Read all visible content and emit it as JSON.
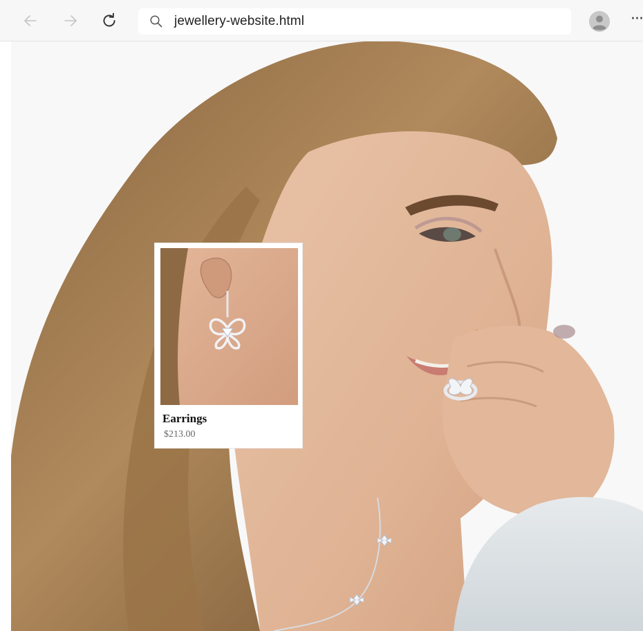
{
  "browser": {
    "address_bar": {
      "url": "jewellery-website.html",
      "search_icon": "search-icon"
    },
    "buttons": {
      "back_icon": "arrow-left-icon",
      "forward_icon": "arrow-right-icon",
      "reload_icon": "reload-icon",
      "profile_icon": "profile-avatar-icon",
      "more_label": "···"
    }
  },
  "hero": {
    "image": "woman-wearing-butterfly-jewellery-photo"
  },
  "product_card": {
    "image": "butterfly-earring-photo",
    "title": "Earrings",
    "price": "$213.00"
  },
  "colors": {
    "toolbar_bg": "#f7f7f7",
    "card_bg": "#ffffff",
    "price_text": "#666666"
  }
}
